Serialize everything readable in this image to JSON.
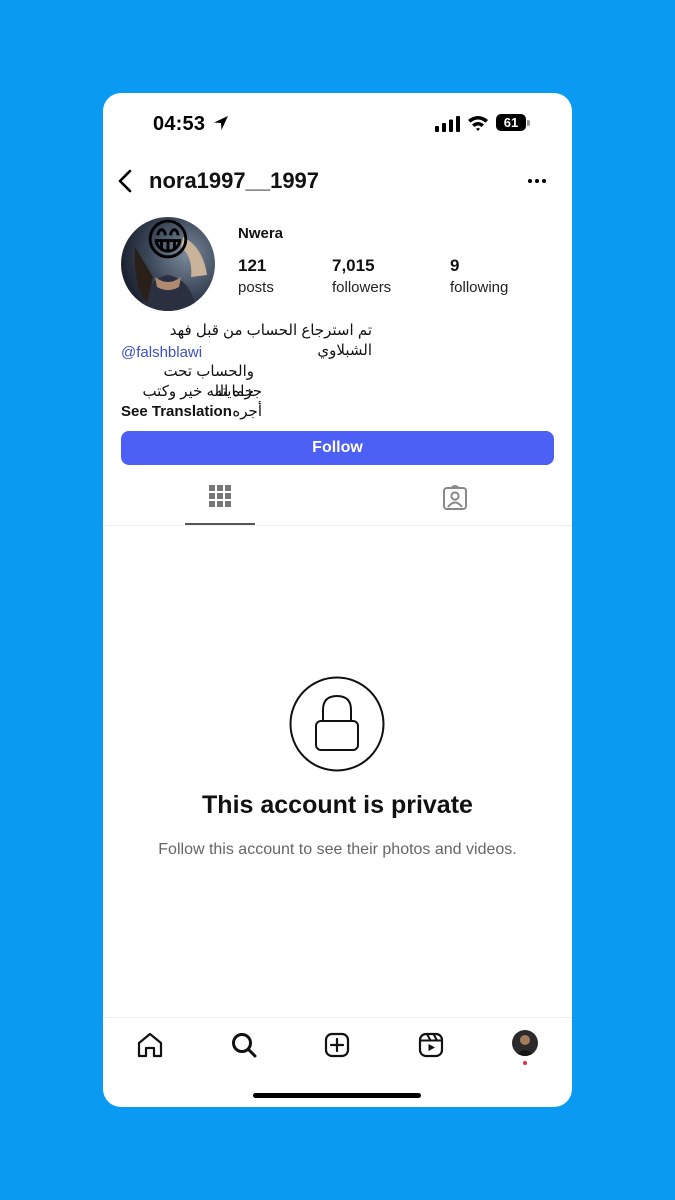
{
  "status_bar": {
    "time": "04:53",
    "battery": "61"
  },
  "header": {
    "username": "nora1997__1997"
  },
  "profile": {
    "display_name": "Nwera",
    "stats": [
      {
        "value": "121",
        "label": "posts"
      },
      {
        "value": "7,015",
        "label": "followers"
      },
      {
        "value": "9",
        "label": "following"
      }
    ],
    "bio_line1": "تم استرجاع الحساب من قبل فهد الشبلاوي",
    "mention": "@falshblawi",
    "bio_line2": "والحساب تحت حمايته",
    "bio_line3": "جزاه الله خير وكتب أجره",
    "see_translation": "See Translation",
    "avatar_emoji": "😁"
  },
  "follow_button": {
    "label": "Follow",
    "color": "#4d60f5"
  },
  "tabs": [
    "grid-icon",
    "tagged-icon"
  ],
  "private_notice": {
    "title": "This account is private",
    "subtitle": "Follow this account to see their photos and videos."
  },
  "bottom_nav": [
    "home-icon",
    "search-icon",
    "create-icon",
    "reels-icon",
    "profile-avatar"
  ],
  "colors": {
    "background": "#0a9af2",
    "mention": "#3b51c6",
    "notification_dot": "#e62e3f"
  }
}
